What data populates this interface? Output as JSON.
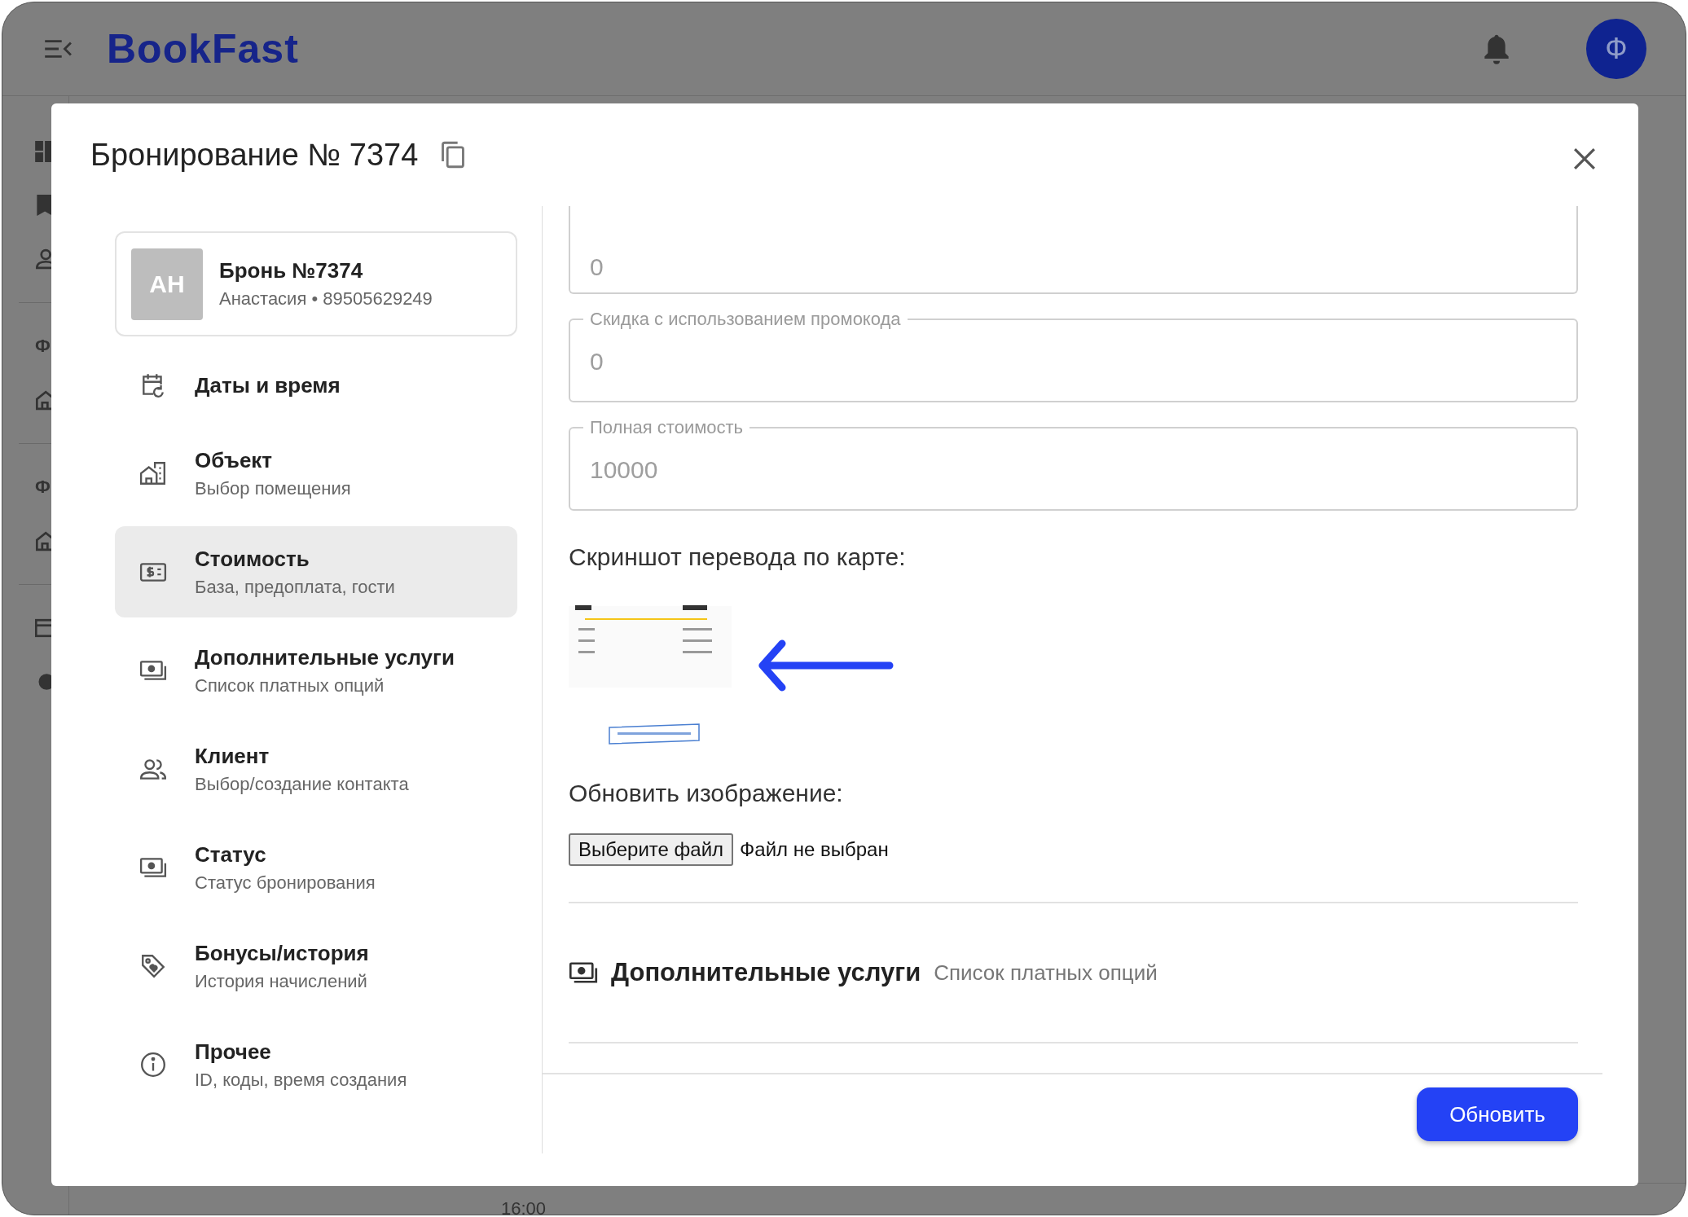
{
  "app_bar": {
    "logo": "BookFast",
    "avatar": "Ф"
  },
  "background": {
    "sidebar_labels": [
      "Ф",
      "Ф"
    ],
    "time_label": "16:00"
  },
  "modal": {
    "title": "Бронирование № 7374"
  },
  "booking_card": {
    "initials": "АН",
    "title": "Бронь №7374",
    "subtitle": "Анастасия • 89505629249"
  },
  "nav": [
    {
      "kind": "calendar",
      "label": "Даты и время",
      "selected": false
    },
    {
      "kind": "building",
      "label": "Объект",
      "sublabel": "Выбор помещения",
      "selected": false
    },
    {
      "kind": "cash",
      "label": "Стоимость",
      "sublabel": "База, предоплата, гости",
      "selected": true
    },
    {
      "kind": "money",
      "label": "Дополнительные услуги",
      "sublabel": "Список платных опций",
      "selected": false
    },
    {
      "kind": "people",
      "label": "Клиент",
      "sublabel": "Выбор/создание контакта",
      "selected": false
    },
    {
      "kind": "money",
      "label": "Статус",
      "sublabel": "Статус бронирования",
      "selected": false
    },
    {
      "kind": "tag",
      "label": "Бонусы/история",
      "sublabel": "История начислений",
      "selected": false
    },
    {
      "kind": "info",
      "label": "Прочее",
      "sublabel": "ID, коды, время создания",
      "selected": false
    }
  ],
  "fields": [
    {
      "value": "0"
    },
    {
      "label": "Скидка с использованием промокода",
      "value": "0"
    },
    {
      "label": "Полная стоимость",
      "value": "10000"
    }
  ],
  "screenshot": {
    "heading": "Скриншот перевода по карте:"
  },
  "upload": {
    "heading": "Обновить изображение:",
    "button": "Выберите файл",
    "status": "Файл не выбран"
  },
  "section": {
    "kind": "money",
    "title": "Дополнительные услуги",
    "subtitle": "Список платных опций"
  },
  "submit_button": "Обновить"
}
